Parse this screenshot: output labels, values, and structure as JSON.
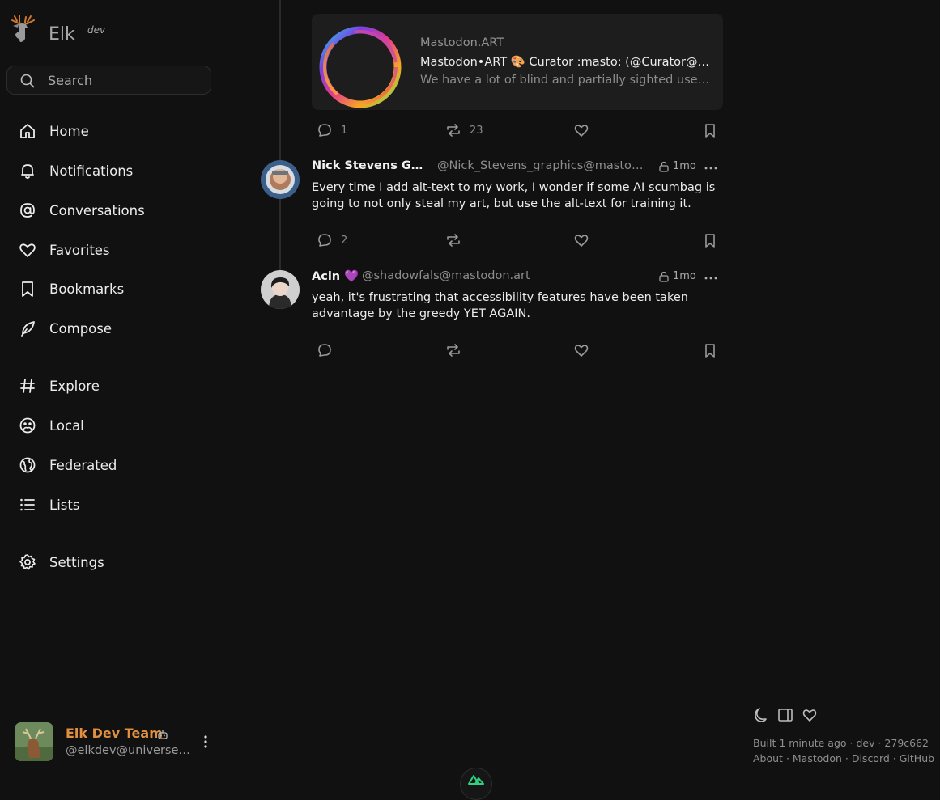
{
  "app": {
    "name": "Elk",
    "badge": "dev"
  },
  "search": {
    "placeholder": "Search"
  },
  "nav": {
    "home": "Home",
    "notifications": "Notifications",
    "conversations": "Conversations",
    "favorites": "Favorites",
    "bookmarks": "Bookmarks",
    "compose": "Compose",
    "explore": "Explore",
    "local": "Local",
    "federated": "Federated",
    "lists": "Lists",
    "settings": "Settings"
  },
  "user": {
    "display_name": "Elk Dev Team",
    "handle": "@elkdev@universeodon.com"
  },
  "card": {
    "site": "Mastodon.ART",
    "title": "Mastodon•ART 🎨 Curator :masto: (@Curator@mastodon.art)",
    "description": "We have a lot of blind and partially sighted users on Mastodon.ART"
  },
  "post0": {
    "replies": "1",
    "boosts": "23"
  },
  "post1": {
    "author": "Nick Stevens Graphics",
    "handle": "@Nick_Stevens_graphics@mastodon.art",
    "time": "1mo",
    "text": "Every time I add alt-text to my work, I wonder if some AI scumbag is going to not only steal my art, but use the alt-text for training it.",
    "replies": "2"
  },
  "post2": {
    "author": "Acin 💜",
    "handle": "@shadowfals@mastodon.art",
    "time": "1mo",
    "text": "yeah, it's frustrating that accessibility features have been taken advantage by the greedy YET AGAIN."
  },
  "footer": {
    "build": "Built 1 minute ago · dev · 279c662",
    "about": "About",
    "mastodon": "Mastodon",
    "discord": "Discord",
    "github": "GitHub",
    "sep": " · "
  },
  "colors": {
    "accent": "#e0903e",
    "background": "#111111",
    "card": "#1d1d1d"
  }
}
